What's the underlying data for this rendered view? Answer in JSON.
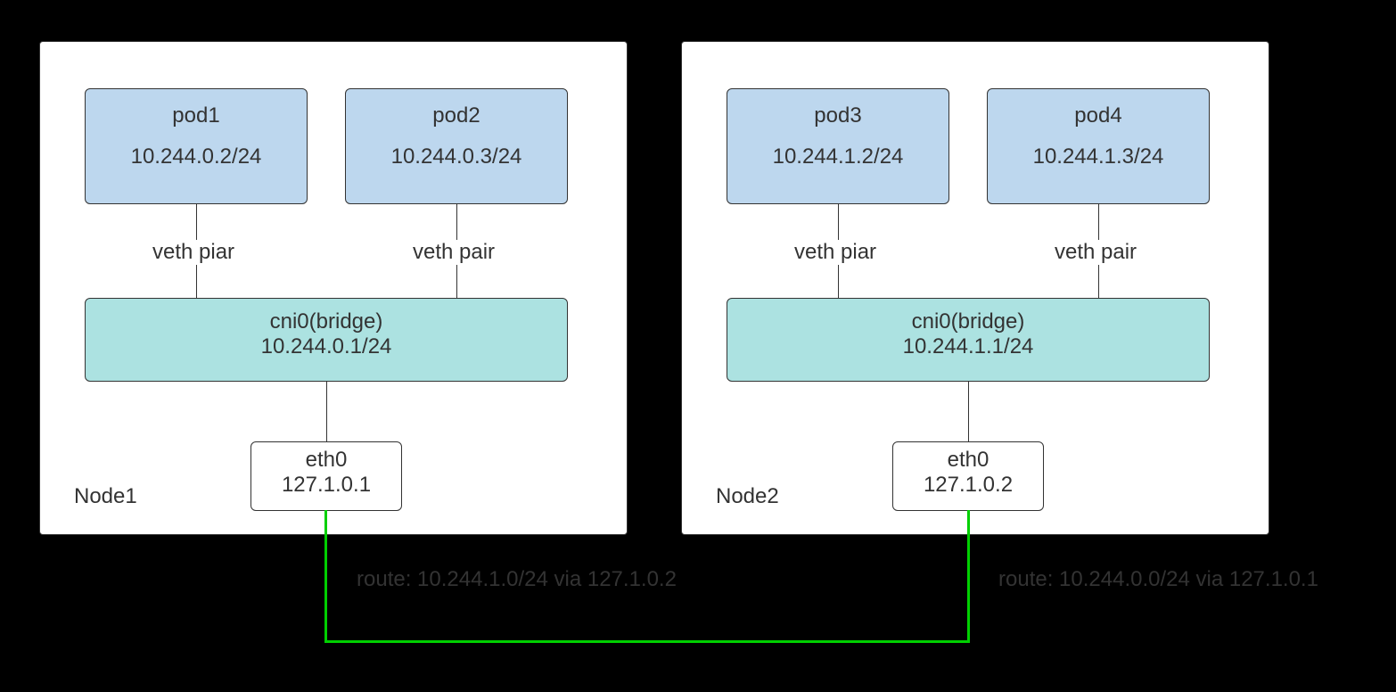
{
  "node1": {
    "label": "Node1",
    "pod1": {
      "name": "pod1",
      "ip": "10.244.0.2/24"
    },
    "pod2": {
      "name": "pod2",
      "ip": "10.244.0.3/24"
    },
    "bridge": {
      "name": "cni0(bridge)",
      "ip": "10.244.0.1/24"
    },
    "eth": {
      "name": "eth0",
      "ip": "127.1.0.1"
    },
    "veth1": "veth piar",
    "veth2": "veth pair"
  },
  "node2": {
    "label": "Node2",
    "pod3": {
      "name": "pod3",
      "ip": "10.244.1.2/24"
    },
    "pod4": {
      "name": "pod4",
      "ip": "10.244.1.3/24"
    },
    "bridge": {
      "name": "cni0(bridge)",
      "ip": "10.244.1.1/24"
    },
    "eth": {
      "name": "eth0",
      "ip": "127.1.0.2"
    },
    "veth1": "veth piar",
    "veth2": "veth pair"
  },
  "route1": "route: 10.244.1.0/24 via 127.1.0.2",
  "route2": "route: 10.244.0.0/24 via 127.1.0.1"
}
